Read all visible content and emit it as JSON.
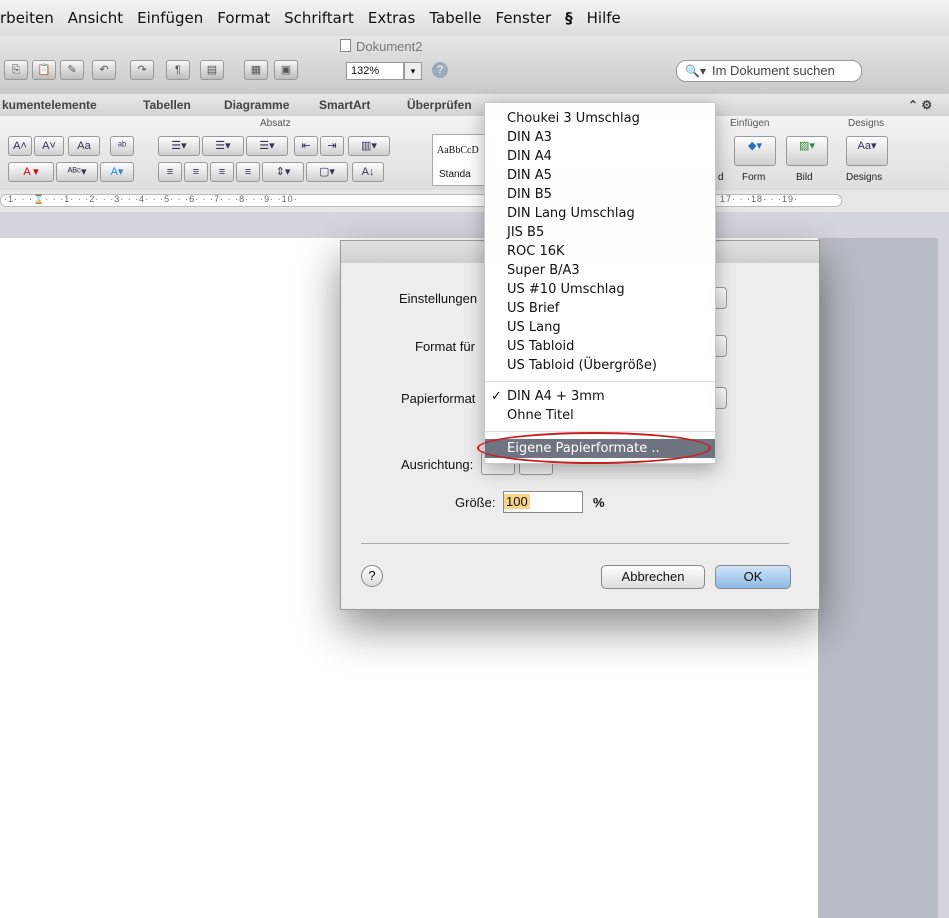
{
  "menubar": {
    "items": [
      "rbeiten",
      "Ansicht",
      "Einfügen",
      "Format",
      "Schriftart",
      "Extras",
      "Tabelle",
      "Fenster",
      "Hilfe"
    ]
  },
  "window": {
    "title": "Dokument2"
  },
  "toolbar": {
    "zoom": "132%",
    "search_placeholder": "Im Dokument suchen"
  },
  "ribbon": {
    "tabs": [
      "kumentelemente",
      "Tabellen",
      "Diagramme",
      "SmartArt",
      "Überprüfen"
    ],
    "group_absatz": "Absatz",
    "group_einfuegen": "Einfügen",
    "group_designs": "Designs",
    "style_preview": "AaBbCcD",
    "style_name": "Standa",
    "btn_form": "Form",
    "btn_bild": "Bild",
    "btn_designs": "Designs",
    "partial_d": "d"
  },
  "ruler": {
    "left_numbers": "·1· · ·⌛· · ·1· · ·2· · ·3· · ·4· · ·5· · ·6· · ·7· · ·8· · ·9· ·10·",
    "right_numbers": "17· · ·18· · ·19·"
  },
  "dialog": {
    "label_settings": "Einstellungen",
    "label_format_for": "Format für",
    "label_paper": "Papierformat",
    "label_orientation": "Ausrichtung:",
    "label_size": "Größe:",
    "size_value": "100",
    "size_unit": "%",
    "help": "?",
    "cancel": "Abbrechen",
    "ok": "OK"
  },
  "paper_menu": {
    "items": [
      "Choukei 3 Umschlag",
      "DIN A3",
      "DIN A4",
      "DIN A5",
      "DIN B5",
      "DIN Lang Umschlag",
      "JIS B5",
      "ROC 16K",
      "Super B/A3",
      "US #10 Umschlag",
      "US Brief",
      "US Lang",
      "US Tabloid",
      "US Tabloid (Übergröße)"
    ],
    "selected": "DIN A4 + 3mm",
    "extra": "Ohne Titel",
    "custom": "Eigene Papierformate ..",
    "checkmark": "✓"
  }
}
